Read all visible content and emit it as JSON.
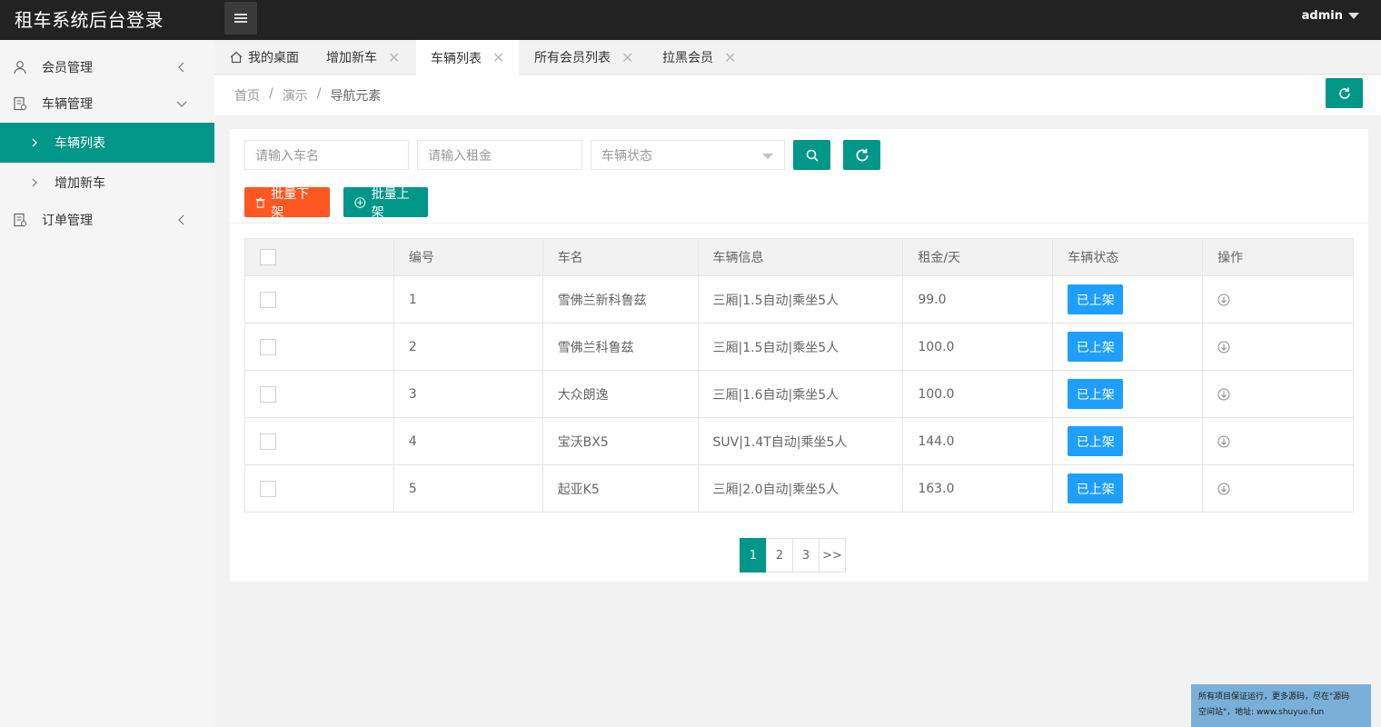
{
  "header": {
    "title": "租车系统后台登录",
    "user": "admin"
  },
  "sidebar": {
    "items": [
      {
        "label": "会员管理"
      },
      {
        "label": "车辆管理"
      },
      {
        "label": "订单管理"
      }
    ],
    "sub_items": [
      {
        "label": "车辆列表",
        "active": true
      },
      {
        "label": "增加新车",
        "active": false
      }
    ]
  },
  "tabs": [
    {
      "label": "我的桌面"
    },
    {
      "label": "增加新车"
    },
    {
      "label": "车辆列表"
    },
    {
      "label": "所有会员列表"
    },
    {
      "label": "拉黑会员"
    }
  ],
  "breadcrumb": [
    "首页",
    "/",
    "演示",
    "/",
    "导航元素"
  ],
  "search": {
    "name_placeholder": "请输入车名",
    "rent_placeholder": "请输入租金",
    "status_placeholder": "车辆状态"
  },
  "actions": {
    "batch_off": "批量下架",
    "batch_on": "批量上架"
  },
  "table": {
    "headers": [
      "编号",
      "车名",
      "车辆信息",
      "租金/天",
      "车辆状态",
      "操作"
    ],
    "rows": [
      {
        "id": "1",
        "name": "雪佛兰新科鲁兹",
        "info": "三厢|1.5自动|乘坐5人",
        "rent": "99.0",
        "status": "已上架"
      },
      {
        "id": "2",
        "name": "雪佛兰科鲁兹",
        "info": "三厢|1.5自动|乘坐5人",
        "rent": "100.0",
        "status": "已上架"
      },
      {
        "id": "3",
        "name": "大众朗逸",
        "info": "三厢|1.6自动|乘坐5人",
        "rent": "100.0",
        "status": "已上架"
      },
      {
        "id": "4",
        "name": "宝沃BX5",
        "info": "SUV|1.4T自动|乘坐5人",
        "rent": "144.0",
        "status": "已上架"
      },
      {
        "id": "5",
        "name": "起亚K5",
        "info": "三厢|2.0自动|乘坐5人",
        "rent": "163.0",
        "status": "已上架"
      }
    ]
  },
  "pagination": {
    "pages": [
      "1",
      "2",
      "3"
    ],
    "next": ">>",
    "current": "1"
  },
  "watermark": {
    "line1": "所有项目保证运行，更多源码，尽在\"源码",
    "line2": "空间站\"，地址: www.shuyue.fun"
  },
  "colors": {
    "header_bg": "#222222",
    "accent": "#009688",
    "danger": "#ff5722",
    "status_blue": "#1e9fff"
  }
}
